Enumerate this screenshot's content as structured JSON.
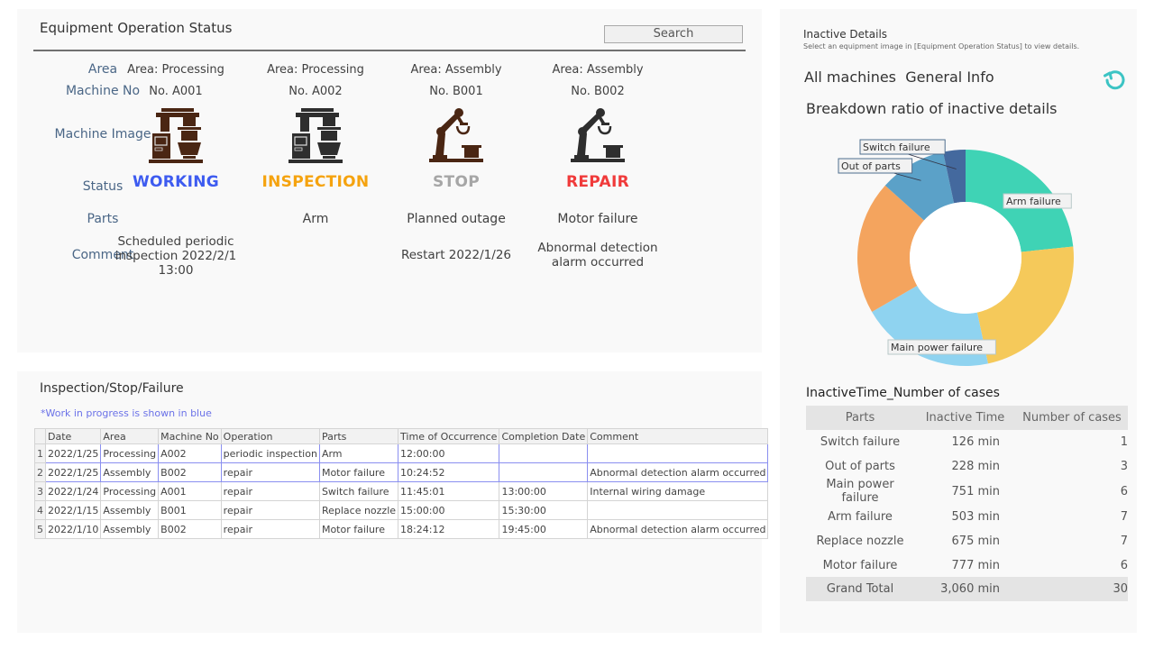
{
  "status_panel": {
    "title": "Equipment Operation Status",
    "search_label": "Search",
    "row_labels": {
      "area": "Area",
      "machine_no": "Machine No",
      "machine_image": "Machine Image",
      "status": "Status",
      "parts": "Parts",
      "comment": "Comment"
    },
    "machines": [
      {
        "area": "Area: Processing",
        "machine_no": "No. A001",
        "icon": "processing-machine-icon",
        "icon_color": "#4a2613",
        "status": "WORKING",
        "status_color": "#3d5bf0",
        "parts": "",
        "comment": "Scheduled periodic inspection 2022/2/1 13:00"
      },
      {
        "area": "Area: Processing",
        "machine_no": "No. A002",
        "icon": "processing-machine-icon",
        "icon_color": "#2e2e2e",
        "status": "INSPECTION",
        "status_color": "#f5a30f",
        "parts": "Arm",
        "comment": ""
      },
      {
        "area": "Area: Assembly",
        "machine_no": "No. B001",
        "icon": "robot-arm-icon",
        "icon_color": "#4a2613",
        "status": "STOP",
        "status_color": "#a6a6a6",
        "parts": "Planned outage",
        "comment": "Restart 2022/1/26"
      },
      {
        "area": "Area: Assembly",
        "machine_no": "No. B002",
        "icon": "robot-arm-icon",
        "icon_color": "#2e2e2e",
        "status": "REPAIR",
        "status_color": "#f03a3a",
        "parts": "Motor failure",
        "comment": "Abnormal detection alarm occurred"
      }
    ]
  },
  "inspection_panel": {
    "title": "Inspection/Stop/Failure",
    "note": "*Work in progress is shown in blue",
    "note_color": "#6b72e8",
    "columns": [
      "Date",
      "Area",
      "Machine No",
      "Operation",
      "Parts",
      "Time of Occurrence",
      "Completion Date",
      "Comment"
    ],
    "rows": [
      {
        "n": "1",
        "wip": true,
        "cells": [
          "2022/1/25",
          "Processing",
          "A002",
          "periodic inspection",
          "Arm",
          "12:00:00",
          "",
          ""
        ]
      },
      {
        "n": "2",
        "wip": true,
        "cells": [
          "2022/1/25",
          "Assembly",
          "B002",
          "repair",
          "Motor failure",
          "10:24:52",
          "",
          "Abnormal detection alarm occurred"
        ]
      },
      {
        "n": "3",
        "wip": false,
        "cells": [
          "2022/1/24",
          "Processing",
          "A001",
          "repair",
          "Switch failure",
          "11:45:01",
          "13:00:00",
          "Internal wiring damage"
        ]
      },
      {
        "n": "4",
        "wip": false,
        "cells": [
          "2022/1/15",
          "Assembly",
          "B001",
          "repair",
          "Replace nozzle",
          "15:00:00",
          "15:30:00",
          ""
        ]
      },
      {
        "n": "5",
        "wip": false,
        "cells": [
          "2022/1/10",
          "Assembly",
          "B002",
          "repair",
          "Motor failure",
          "18:24:12",
          "19:45:00",
          "Abnormal detection alarm occurred"
        ]
      }
    ]
  },
  "inactive_panel": {
    "title": "Inactive Details",
    "subtitle": "Select an equipment image in [Equipment Operation Status] to view details.",
    "general_info": "All machines  General Info",
    "refresh_icon": "refresh-icon",
    "refresh_color": "#3cc4c4",
    "breakdown_title": "Breakdown ratio of inactive details",
    "summary_title": "InactiveTime_Number of cases",
    "summary_columns": [
      "Parts",
      "Inactive Time",
      "Number of cases"
    ],
    "summary_rows": [
      {
        "part": "Switch failure",
        "time": "126 min",
        "cases": "1"
      },
      {
        "part": "Out of parts",
        "time": "228 min",
        "cases": "3"
      },
      {
        "part": "Main power failure",
        "time": "751 min",
        "cases": "6"
      },
      {
        "part": "Arm failure",
        "time": "503 min",
        "cases": "7"
      },
      {
        "part": "Replace nozzle",
        "time": "675 min",
        "cases": "7"
      },
      {
        "part": "Motor failure",
        "time": "777 min",
        "cases": "6"
      }
    ],
    "total": {
      "part": "Grand Total",
      "time": "3,060 min",
      "cases": "30"
    }
  },
  "chart_data": {
    "type": "pie",
    "title": "Breakdown ratio of inactive details",
    "donut": true,
    "start": "top",
    "direction": "clockwise",
    "slices": [
      {
        "label": "Arm failure",
        "value": 7,
        "color": "#3fd3b5",
        "show_label": true
      },
      {
        "label": "Replace nozzle",
        "value": 7,
        "color": "#f5c95a",
        "show_label": false
      },
      {
        "label": "Main power failure",
        "value": 6,
        "color": "#8fd3f0",
        "show_label": true
      },
      {
        "label": "Motor failure",
        "value": 6,
        "color": "#f4a45e",
        "show_label": false
      },
      {
        "label": "Out of parts",
        "value": 3,
        "color": "#5ba1c8",
        "show_label": true
      },
      {
        "label": "Switch failure",
        "value": 1,
        "color": "#44699e",
        "show_label": true
      }
    ]
  }
}
